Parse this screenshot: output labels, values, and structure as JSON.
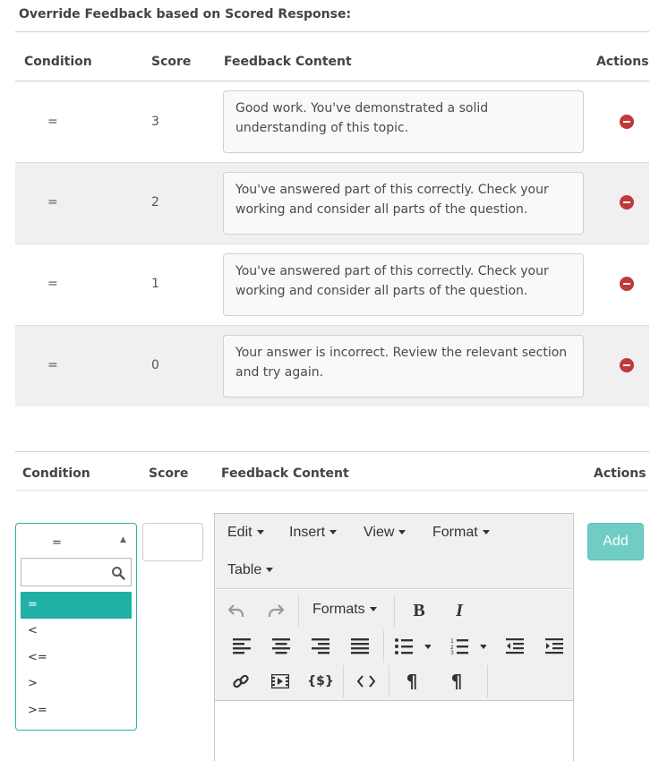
{
  "section_title": "Override Feedback based on Scored Response:",
  "table": {
    "headers": {
      "condition": "Condition",
      "score": "Score",
      "feedback": "Feedback Content",
      "actions": "Actions"
    },
    "rows": [
      {
        "condition": "=",
        "score": "3",
        "feedback": "Good work. You've demonstrated a solid understanding of this topic."
      },
      {
        "condition": "=",
        "score": "2",
        "feedback": "You've answered part of this correctly. Check your working and consider all parts of the question."
      },
      {
        "condition": "=",
        "score": "1",
        "feedback": "You've answered part of this correctly. Check your working and consider all parts of the question."
      },
      {
        "condition": "=",
        "score": "0",
        "feedback": "Your answer is incorrect. Review the relevant section and try again."
      }
    ]
  },
  "add_form": {
    "headers": {
      "condition": "Condition",
      "score": "Score",
      "feedback": "Feedback Content",
      "actions": "Actions"
    },
    "condition_select": {
      "selected": "=",
      "search_placeholder": "",
      "options": [
        "=",
        "<",
        "<=",
        ">",
        ">="
      ]
    },
    "score_value": "",
    "editor": {
      "menus": [
        "Edit",
        "Insert",
        "View",
        "Format",
        "Table"
      ],
      "formats_label": "Formats"
    },
    "add_label": "Add"
  },
  "colors": {
    "accent": "#1fb1a5",
    "remove": "#c0393b",
    "add_button": "#6fcdc6"
  }
}
